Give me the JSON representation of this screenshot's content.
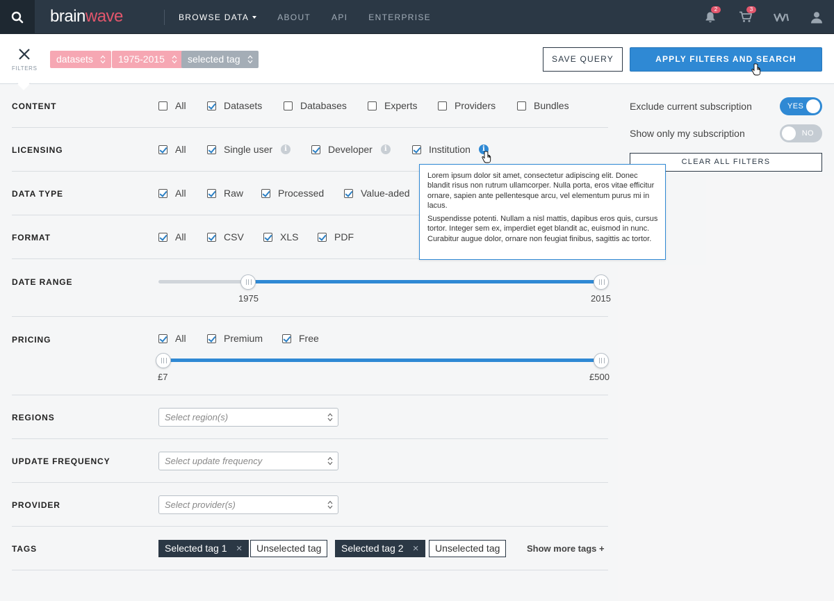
{
  "nav": {
    "logo_a": "brain",
    "logo_b": "wave",
    "links": [
      "BROWSE DATA",
      "ABOUT",
      "API",
      "ENTERPRISE"
    ],
    "notifications_count": "2",
    "cart_count": "3"
  },
  "filterbar": {
    "filters_label": "FILTERS",
    "chips": [
      "datasets",
      "1975-2015",
      "selected tag"
    ],
    "save_query": "SAVE QUERY",
    "apply": "APPLY FILTERS AND SEARCH"
  },
  "content": {
    "label": "CONTENT",
    "options": [
      {
        "label": "All",
        "checked": false
      },
      {
        "label": "Datasets",
        "checked": true
      },
      {
        "label": "Databases",
        "checked": false
      },
      {
        "label": "Experts",
        "checked": false
      },
      {
        "label": "Providers",
        "checked": false
      },
      {
        "label": "Bundles",
        "checked": false
      }
    ]
  },
  "licensing": {
    "label": "LICENSING",
    "options": [
      "All",
      "Single user",
      "Developer",
      "Institution"
    ]
  },
  "data_type": {
    "label": "DATA TYPE",
    "options": [
      "All",
      "Raw",
      "Processed",
      "Value-aded"
    ]
  },
  "format": {
    "label": "FORMAT",
    "options": [
      "All",
      "CSV",
      "XLS",
      "PDF"
    ]
  },
  "date_range": {
    "label": "DATE RANGE",
    "min": "1975",
    "max": "2015"
  },
  "pricing": {
    "label": "PRICING",
    "options": [
      "All",
      "Premium",
      "Free"
    ],
    "min": "£7",
    "max": "£500"
  },
  "regions": {
    "label": "REGIONS",
    "placeholder": "Select region(s)"
  },
  "update_frequency": {
    "label": "UPDATE FREQUENCY",
    "placeholder": "Select update frequency"
  },
  "provider": {
    "label": "PROVIDER",
    "placeholder": "Select provider(s)"
  },
  "tags": {
    "label": "TAGS",
    "items": [
      "Selected tag 1",
      "Unselected tag",
      "Selected tag 2",
      "Unselected tag"
    ],
    "show_more": "Show more tags"
  },
  "right": {
    "exclude_label": "Exclude current subscription",
    "exclude_state": "YES",
    "only_mine_label": "Show only my subscription",
    "only_mine_state": "NO",
    "clear_all": "CLEAR ALL FILTERS"
  },
  "tooltip": {
    "p1": "Lorem ipsum dolor sit amet, consectetur adipiscing elit. Donec blandit risus non rutrum ullamcorper. Nulla porta, eros vitae efficitur ornare, sapien ante pellentesque arcu, vel elementum purus mi in lacus.",
    "p2": "Suspendisse potenti. Nullam a nisl mattis, dapibus eros quis, cursus tortor. Integer sem ex, imperdiet eget blandit ac, euismod in nunc. Curabitur augue dolor, ornare non feugiat finibus, sagittis ac tortor."
  },
  "colors": {
    "accent": "#2f89d4",
    "brand": "#e2566c",
    "nav": "#2b3845"
  }
}
